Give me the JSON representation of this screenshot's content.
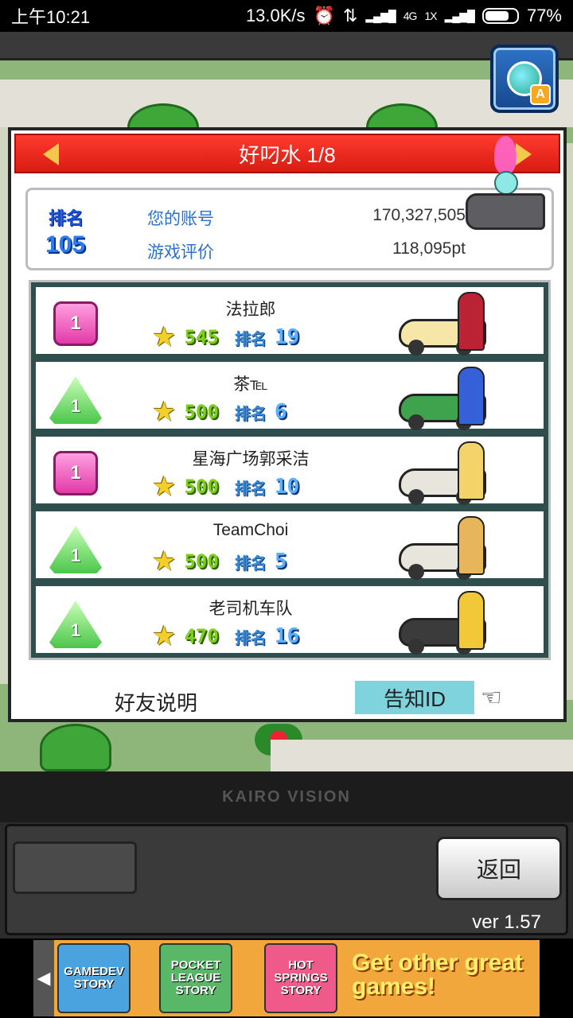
{
  "status_bar": {
    "time": "上午10:21",
    "speed": "13.0K/s",
    "battery": "77%",
    "network": "4G",
    "sim": "1X"
  },
  "panel": {
    "title": "好叼水 1/8",
    "summary": {
      "rank_label": "排名",
      "rank_value": "105",
      "account_label": "您的账号",
      "account_value": "170,327,505",
      "rating_label": "游戏评价",
      "rating_value": "118,095pt"
    },
    "rows": [
      {
        "badge": "1",
        "badge_type": "pink",
        "name": "法拉郎",
        "score": "545",
        "rank_label": "排名",
        "rank": "19",
        "car_color": "#f6e6a8",
        "person_color": "#b23"
      },
      {
        "badge": "1",
        "badge_type": "green",
        "name": "茶℡",
        "score": "500",
        "rank_label": "排名",
        "rank": "6",
        "car_color": "#3fa34d",
        "person_color": "#3560d8"
      },
      {
        "badge": "1",
        "badge_type": "pink",
        "name": "星海广场郭采洁",
        "score": "500",
        "rank_label": "排名",
        "rank": "10",
        "car_color": "#e8e6dc",
        "person_color": "#f3d36a"
      },
      {
        "badge": "1",
        "badge_type": "green",
        "name": "TeamChoi",
        "score": "500",
        "rank_label": "排名",
        "rank": "5",
        "car_color": "#e8e6dc",
        "person_color": "#e8b65a"
      },
      {
        "badge": "1",
        "badge_type": "green",
        "name": "老司机车队",
        "score": "470",
        "rank_label": "排名",
        "rank": "16",
        "car_color": "#3b3b3b",
        "person_color": "#f0c838"
      }
    ],
    "friend_info_label": "好友说明",
    "notify_id_label": "告知ID"
  },
  "bottom": {
    "logo_text": "KAIRO VISION",
    "back_label": "返回",
    "version": "ver 1.57"
  },
  "ad": {
    "game1": "GAMEDEV STORY",
    "game2": "POCKET LEAGUE STORY",
    "game3": "HOT SPRINGS STORY",
    "cta": "Get other great games!"
  },
  "colors": {
    "header_red": "#e8271c",
    "notify_bg": "#7fd3dc",
    "score_green": "#7dcf1a",
    "rank_blue": "#5bb0ff"
  }
}
